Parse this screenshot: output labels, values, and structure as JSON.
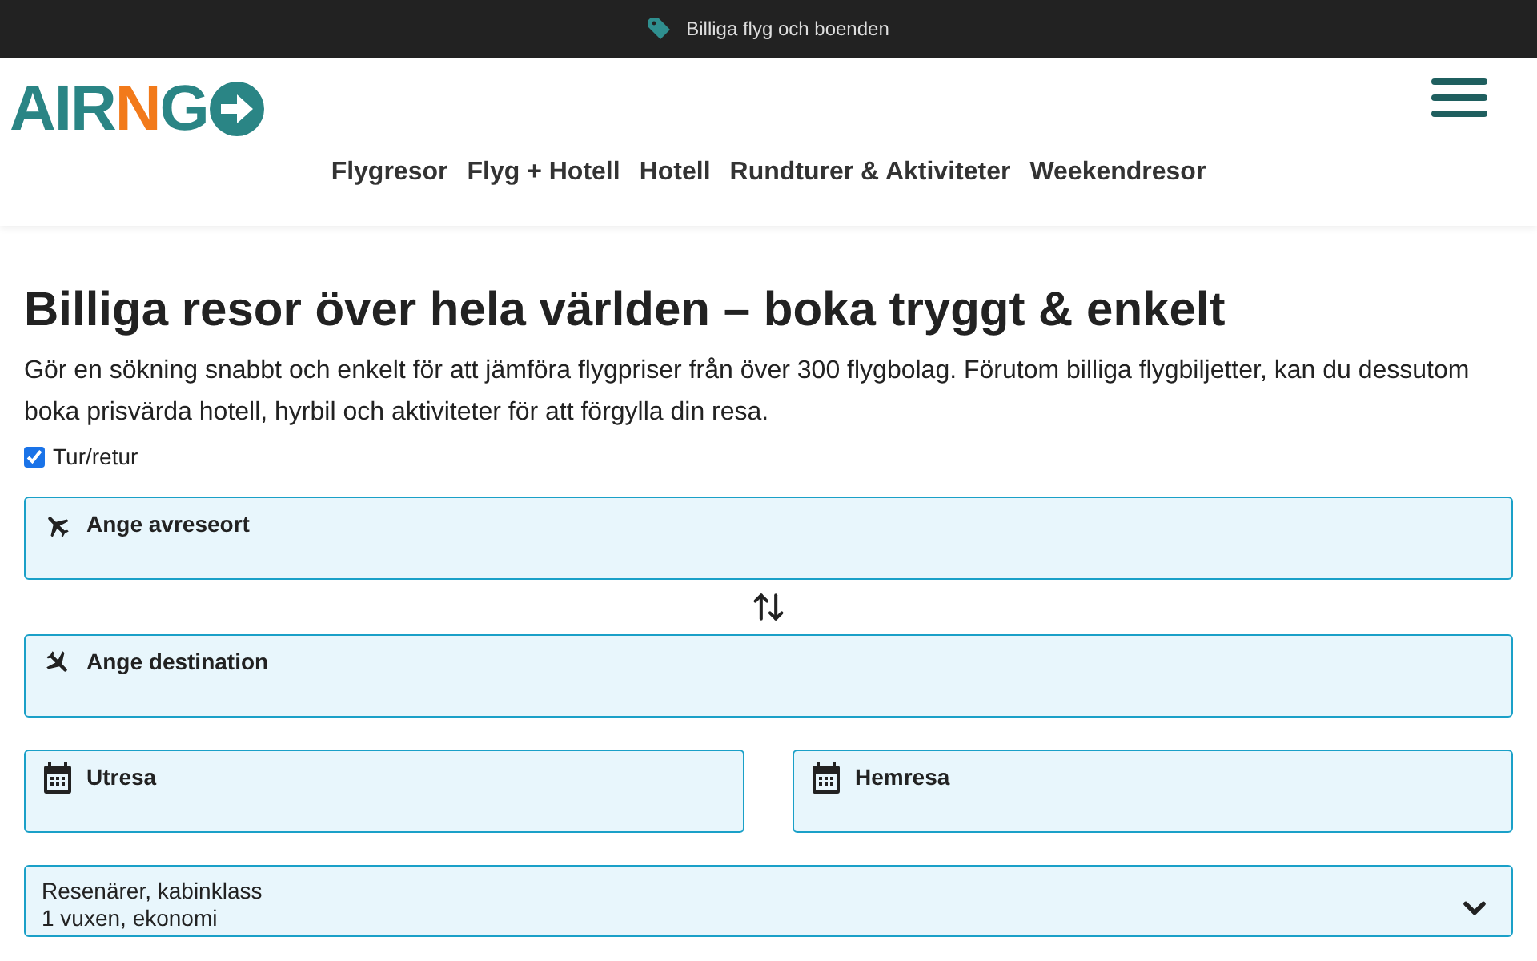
{
  "promo_bar": {
    "text": "Billiga flyg och boenden"
  },
  "logo": {
    "main": "AIR",
    "accent": "N",
    "end": "G"
  },
  "nav": [
    "Flygresor",
    "Flyg + Hotell",
    "Hotell",
    "Rundturer & Aktiviteter",
    "Weekendresor"
  ],
  "heading": "Billiga resor över hela världen – boka tryggt & enkelt",
  "intro": "Gör en sökning snabbt och enkelt för att jämföra flygpriser från över 300 flygbolag. Förutom billiga flygbiljetter, kan du dessutom boka prisvärda hotell, hyrbil och aktiviteter för att förgylla din resa.",
  "round_trip": {
    "label": "Tur/retur",
    "checked": true
  },
  "origin": {
    "placeholder": "Ange avreseort"
  },
  "destination": {
    "placeholder": "Ange destination"
  },
  "dates": [
    {
      "placeholder": "Utresa"
    },
    {
      "placeholder": "Hemresa"
    }
  ],
  "travelers": {
    "label": "Resenärer, kabinklass",
    "value": "1 vuxen, ekonomi"
  }
}
